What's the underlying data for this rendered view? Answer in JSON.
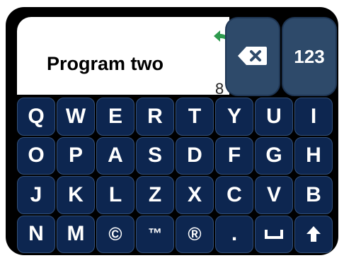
{
  "entry": {
    "text": "Program two",
    "count": "8"
  },
  "buttons": {
    "numbers_label": "123"
  },
  "keyboard": {
    "rows": [
      [
        "Q",
        "W",
        "E",
        "R",
        "T",
        "Y",
        "U",
        "I"
      ],
      [
        "O",
        "P",
        "A",
        "S",
        "D",
        "F",
        "G",
        "H"
      ],
      [
        "J",
        "K",
        "L",
        "Z",
        "X",
        "C",
        "V",
        "B"
      ],
      [
        "N",
        "M",
        "©",
        "™",
        "®",
        "."
      ]
    ]
  },
  "colors": {
    "key_bg": "#0d2650",
    "action_key_bg": "#2e4a6a",
    "undo_arrow": "#2e9a4e",
    "frame": "#000000"
  },
  "icons": {
    "undo": "undo-arrow-icon",
    "backspace": "backspace-icon",
    "space": "space-bar-icon",
    "shift": "shift-up-arrow-icon"
  }
}
